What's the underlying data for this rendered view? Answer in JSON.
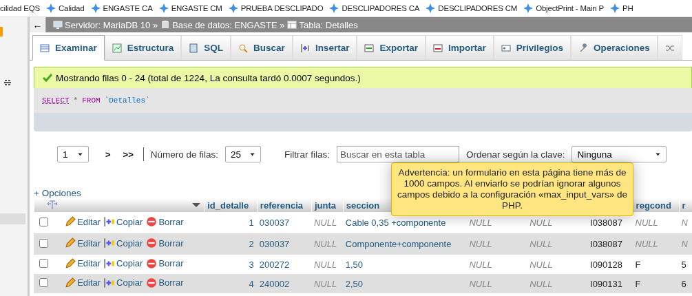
{
  "bookmarks": [
    "cilidad EQS",
    "Calidad",
    "ENGASTE CA",
    "ENGASTE CM",
    "PRUEBA DESCLIPADO",
    "DESCLIPADORES CA",
    "DESCLIPADORES CM",
    "ObjectPrint - Main P",
    "PH"
  ],
  "breadcrumb": {
    "back": "←",
    "items": [
      {
        "text": "Servidor: MariaDB 10 »",
        "kind": "server"
      },
      {
        "text": "Base de datos: ENGASTE »",
        "kind": "database"
      },
      {
        "text": "Tabla: Detalles",
        "kind": "table"
      }
    ]
  },
  "tabs": [
    {
      "label": "Examinar",
      "kind": "browse",
      "selected": true
    },
    {
      "label": "Estructura",
      "kind": "structure",
      "selected": false
    },
    {
      "label": "SQL",
      "kind": "sql",
      "selected": false
    },
    {
      "label": "Buscar",
      "kind": "search",
      "selected": false
    },
    {
      "label": "Insertar",
      "kind": "insert",
      "selected": false
    },
    {
      "label": "Exportar",
      "kind": "export",
      "selected": false
    },
    {
      "label": "Importar",
      "kind": "import",
      "selected": false
    },
    {
      "label": "Privilegios",
      "kind": "privileges",
      "selected": false
    },
    {
      "label": "Operaciones",
      "kind": "operations",
      "selected": false
    },
    {
      "kind": "more",
      "selected": false
    }
  ],
  "message": "Mostrando filas 0 - 24 (total de 1224, La consulta tardó 0.0007 segundos.)",
  "query": {
    "keyword1": "SELECT",
    "star": "*",
    "keyword2": "FROM",
    "table": "`Detalles`"
  },
  "navigation": {
    "page": "1",
    "next": ">",
    "last": ">>",
    "rows_label": "Número de filas:",
    "rows_value": "25",
    "filter_label": "Filtrar filas:",
    "filter_placeholder": "Buscar en esta tabla",
    "sort_label": "Ordenar según la clave:",
    "sort_value": "Ninguna"
  },
  "options_link": "+ Opciones",
  "table": {
    "columns": [
      "id_detalle",
      "referencia",
      "junta",
      "seccion",
      "",
      "",
      "",
      "regcond",
      "r"
    ],
    "rows": [
      {
        "checked": false,
        "edit": "Editar",
        "copy": "Copiar",
        "delete": "Borrar",
        "cells": [
          "1",
          "030037",
          "NULL",
          "Cable 0,35 +componente",
          "NULL",
          "NULL",
          "I038087",
          "NULL",
          "N"
        ]
      },
      {
        "checked": false,
        "edit": "Editar",
        "copy": "Copiar",
        "delete": "Borrar",
        "cells": [
          "2",
          "030037",
          "NULL",
          "Componente+componente",
          "NULL",
          "NULL",
          "I038087",
          "NULL",
          "N"
        ]
      },
      {
        "checked": false,
        "edit": "Editar",
        "copy": "Copiar",
        "delete": "Borrar",
        "cells": [
          "3",
          "200272",
          "NULL",
          "1,50",
          "NULL",
          "NULL",
          "I090128",
          "F",
          "5"
        ]
      },
      {
        "checked": false,
        "edit": "Editar",
        "copy": "Copiar",
        "delete": "Borrar",
        "cells": [
          "4",
          "240002",
          "NULL",
          "2,50",
          "NULL",
          "NULL",
          "I090131",
          "F",
          "6"
        ]
      }
    ]
  },
  "tooltip": "Advertencia: un formulario en esta página tiene más de 1000 campos. Al enviarlo se podrían ignorar algunos campos debido a la configuración «max_input_vars» de PHP."
}
